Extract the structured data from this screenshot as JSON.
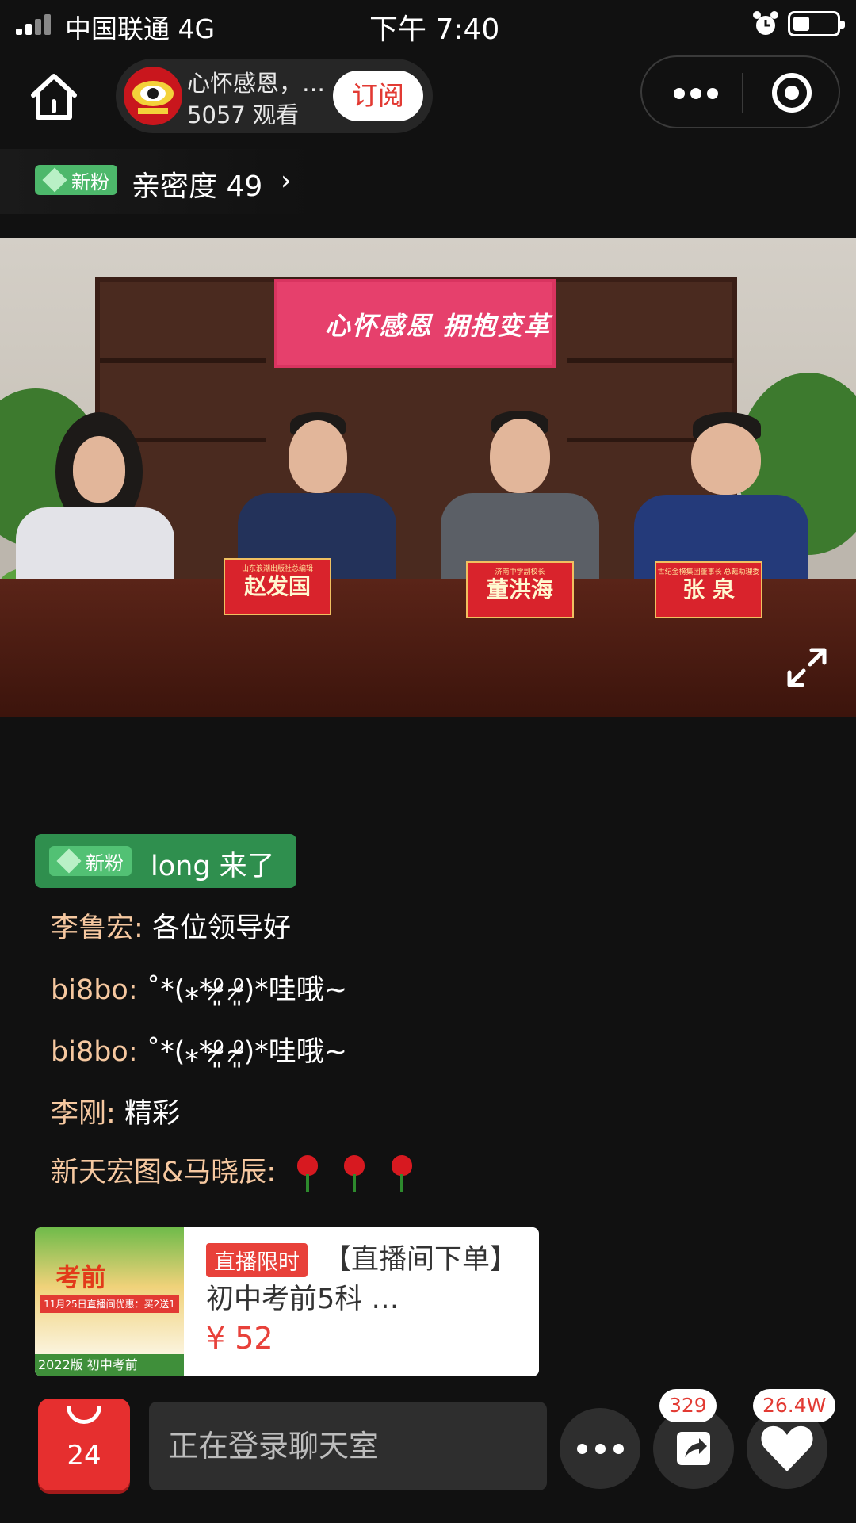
{
  "status_bar": {
    "carrier": "中国联通   4G",
    "time": "下午 7:40"
  },
  "header": {
    "anchor_name": "心怀感恩，…",
    "view_count": "5057 观看",
    "subscribe_label": "订阅"
  },
  "intimacy": {
    "badge": "新粉",
    "text": "亲密度 49",
    "arrow": "›"
  },
  "video": {
    "banner_text": "心怀感恩  拥抱变革",
    "nameplates": [
      {
        "title": "山东浪潮出版社总编辑",
        "name": "赵发国"
      },
      {
        "title": "济南中学副校长",
        "name": "董洪海"
      },
      {
        "title": "世纪金榜集团董事长 总裁助理委",
        "name": "张 泉"
      }
    ]
  },
  "chat": {
    "welcome_badge": "新粉",
    "welcome_text": "long 来了",
    "messages": [
      {
        "user": "李鲁宏",
        "text": "各位领导好"
      },
      {
        "user": "bi8bo",
        "text": "˚*(⁎*⁰̷̴͈ ⁰̷̴͈)*哇哦~"
      },
      {
        "user": "bi8bo",
        "text": "˚*(⁎*⁰̷̴͈ ⁰̷̴͈)*哇哦~"
      },
      {
        "user": "李刚",
        "text": "精彩"
      },
      {
        "user": "新天宏图&马晓辰",
        "text": ""
      }
    ]
  },
  "product": {
    "tag": "直播限时",
    "title": "【直播间下单】初中考前5科 …",
    "price": "¥ 52",
    "thumb_title": "考前",
    "thumb_promo": "11月25日直播间优惠：买2送1",
    "thumb_footer": "2022版  初中考前"
  },
  "bottom_bar": {
    "cart_count": "24",
    "chat_placeholder": "正在登录聊天室",
    "share_count": "329",
    "like_count": "26.4W"
  },
  "colors": {
    "background": "#111111",
    "accent_red": "#e62f2f",
    "fan_green": "#4db86b",
    "chat_username": "#f6c8a0"
  },
  "icons": {
    "home": "home-icon",
    "more": "more-dots-icon",
    "close": "target-close-icon",
    "fullscreen": "fullscreen-icon",
    "cart": "shopping-bag-icon",
    "share": "share-icon",
    "like": "heart-icon"
  }
}
